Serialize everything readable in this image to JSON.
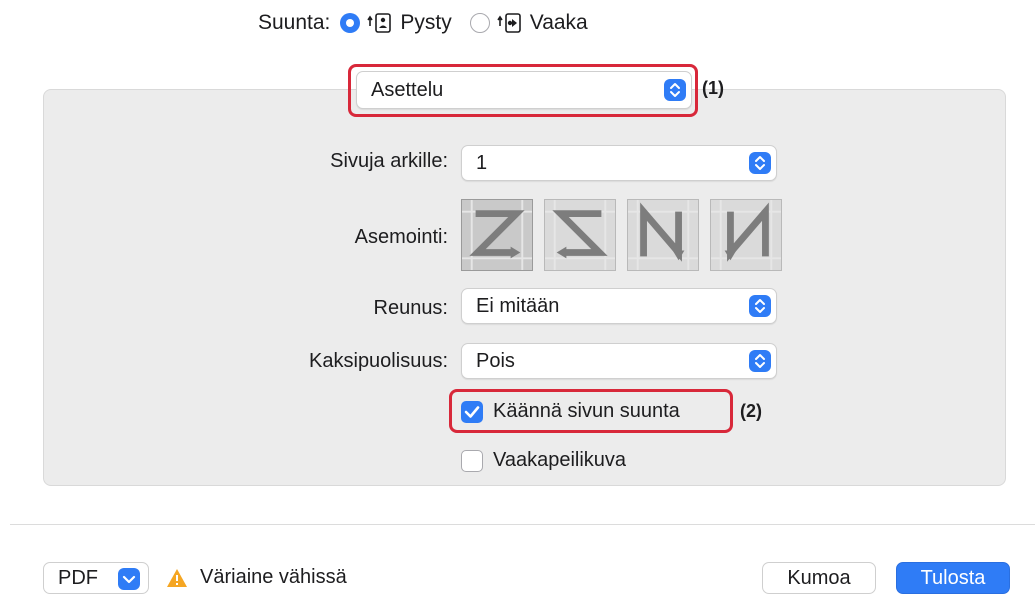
{
  "orientation": {
    "label": "Suunta:",
    "options": [
      {
        "label": "Pysty",
        "selected": true,
        "icon": "portrait-icon"
      },
      {
        "label": "Vaaka",
        "selected": false,
        "icon": "landscape-icon"
      }
    ]
  },
  "section_select": {
    "value": "Asettelu",
    "marker": "(1)"
  },
  "pages_per_sheet": {
    "label": "Sivuja arkille:",
    "value": "1"
  },
  "layout_direction": {
    "label": "Asemointi:",
    "options": [
      {
        "icon": "z-layout-icon",
        "selected": true
      },
      {
        "icon": "reverse-z-layout-icon",
        "selected": false
      },
      {
        "icon": "reverse-n-layout-icon",
        "selected": false
      },
      {
        "icon": "n-layout-icon",
        "selected": false
      }
    ]
  },
  "border": {
    "label": "Reunus:",
    "value": "Ei mitään"
  },
  "two_sided": {
    "label": "Kaksipuolisuus:",
    "value": "Pois"
  },
  "reverse_orientation": {
    "label": "Käännä sivun suunta",
    "checked": true,
    "marker": "(2)"
  },
  "flip_horizontally": {
    "label": "Vaakapeilikuva",
    "checked": false
  },
  "footer": {
    "pdf_label": "PDF",
    "warning_text": "Väriaine vähissä",
    "cancel_label": "Kumoa",
    "print_label": "Tulosta"
  },
  "colors": {
    "accent": "#2f7cf6",
    "highlight": "#d8283a",
    "warning": "#f5a623"
  }
}
